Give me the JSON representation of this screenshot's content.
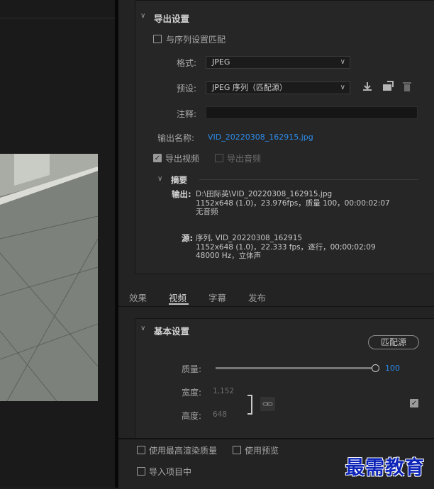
{
  "export_settings": {
    "title": "导出设置",
    "match_sequence_label": "与序列设置匹配",
    "format_label": "格式:",
    "format_value": "JPEG",
    "preset_label": "预设:",
    "preset_value": "JPEG 序列（匹配源）",
    "comment_label": "注释:",
    "comment_value": "",
    "output_name_label": "输出名称:",
    "output_name_value": "VID_20220308_162915.jpg",
    "export_video_label": "导出视频",
    "export_video_checked": true,
    "export_audio_label": "导出音频",
    "export_audio_checked": false
  },
  "summary": {
    "title": "摘要",
    "output_label": "输出:",
    "output_lines": [
      "D:\\田际英\\VID_20220308_162915.jpg",
      "1152x648 (1.0)，23.976fps，质量 100，00:00:02:07",
      "无音频"
    ],
    "source_label": "源:",
    "source_lines": [
      "序列, VID_20220308_162915",
      "1152x648 (1.0)，22.333 fps，逐行，00;00;02;09",
      "48000 Hz，立体声"
    ]
  },
  "tabs": [
    {
      "label": "效果",
      "active": false
    },
    {
      "label": "视频",
      "active": true
    },
    {
      "label": "字幕",
      "active": false
    },
    {
      "label": "发布",
      "active": false
    }
  ],
  "basic_settings": {
    "title": "基本设置",
    "match_source_button": "匹配源",
    "quality_label": "质量:",
    "quality_value": "100",
    "quality_fraction": 1.0,
    "width_label": "宽度:",
    "width_value": "1,152",
    "height_label": "高度:",
    "height_value": "648"
  },
  "bottom": {
    "max_render_label": "使用最高渲染质量",
    "use_preview_label": "使用预览",
    "import_project_label": "导入项目中"
  },
  "watermark": "最需教育",
  "colors": {
    "link": "#2d8ceb",
    "watermark": "#0d24b8"
  }
}
